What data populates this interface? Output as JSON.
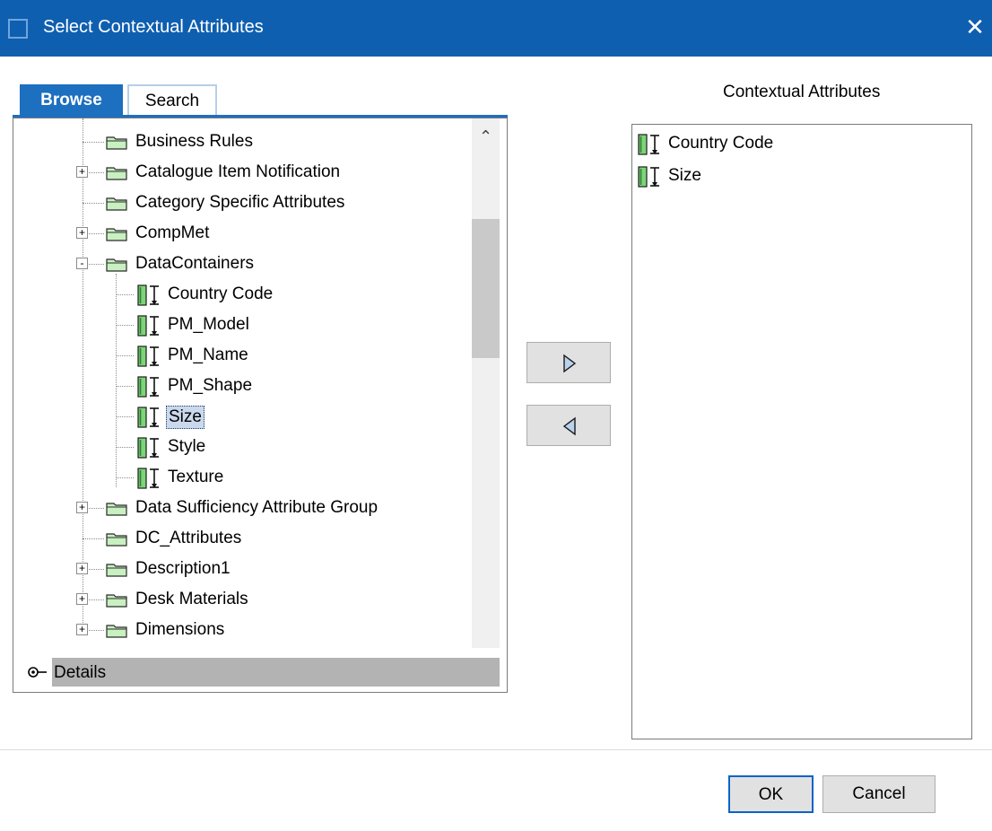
{
  "window": {
    "title": "Select Contextual Attributes",
    "close_glyph": "✕"
  },
  "tabs": {
    "browse_label": "Browse",
    "search_label": "Search",
    "active": "Browse"
  },
  "tree": {
    "items": [
      {
        "label": "Business Rules",
        "type": "folder",
        "level": 1,
        "expander": ""
      },
      {
        "label": "Catalogue Item Notification",
        "type": "folder",
        "level": 1,
        "expander": "+"
      },
      {
        "label": "Category Specific Attributes",
        "type": "folder",
        "level": 1,
        "expander": ""
      },
      {
        "label": "CompMet",
        "type": "folder",
        "level": 1,
        "expander": "+"
      },
      {
        "label": "DataContainers",
        "type": "folder",
        "level": 1,
        "expander": "-"
      },
      {
        "label": "Country Code",
        "type": "attribute",
        "level": 2,
        "expander": ""
      },
      {
        "label": "PM_Model",
        "type": "attribute",
        "level": 2,
        "expander": ""
      },
      {
        "label": "PM_Name",
        "type": "attribute",
        "level": 2,
        "expander": ""
      },
      {
        "label": "PM_Shape",
        "type": "attribute",
        "level": 2,
        "expander": ""
      },
      {
        "label": "Size",
        "type": "attribute",
        "level": 2,
        "expander": "",
        "selected": true
      },
      {
        "label": "Style",
        "type": "attribute",
        "level": 2,
        "expander": ""
      },
      {
        "label": "Texture",
        "type": "attribute",
        "level": 2,
        "expander": ""
      },
      {
        "label": "Data Sufficiency Attribute Group",
        "type": "folder",
        "level": 1,
        "expander": "+"
      },
      {
        "label": "DC_Attributes",
        "type": "folder",
        "level": 1,
        "expander": ""
      },
      {
        "label": "Description1",
        "type": "folder",
        "level": 1,
        "expander": "+"
      },
      {
        "label": "Desk Materials",
        "type": "folder",
        "level": 1,
        "expander": "+"
      },
      {
        "label": "Dimensions",
        "type": "folder",
        "level": 1,
        "expander": "+"
      }
    ]
  },
  "scrollbar": {
    "up_glyph": "⌃"
  },
  "details": {
    "label": "Details"
  },
  "right": {
    "heading": "Contextual Attributes",
    "items": [
      {
        "label": "Country Code"
      },
      {
        "label": "Size"
      }
    ]
  },
  "buttons": {
    "ok": "OK",
    "cancel": "Cancel"
  },
  "colors": {
    "titlebar": "#0f5fb0",
    "tab_active": "#1d6fbf",
    "folder": "#c8f0c0",
    "attribute_bar": "#4caf50",
    "selection": "#cbd9ec"
  }
}
